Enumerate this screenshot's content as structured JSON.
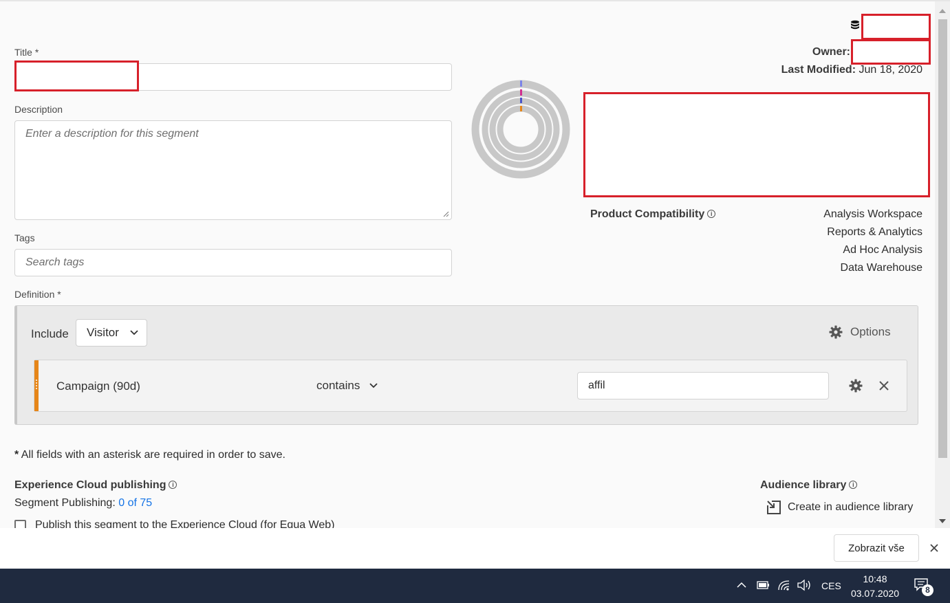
{
  "form": {
    "title_label": "Title",
    "required_mark": "*",
    "description_label": "Description",
    "description_placeholder": "Enter a description for this segment",
    "tags_label": "Tags",
    "tags_placeholder": "Search tags",
    "definition_label": "Definition"
  },
  "meta": {
    "owner_label": "Owner:",
    "last_modified_label": "Last Modified:",
    "last_modified_value": "Jun 18, 2020"
  },
  "compatibility": {
    "label": "Product Compatibility",
    "items": [
      "Analysis Workspace",
      "Reports & Analytics",
      "Ad Hoc Analysis",
      "Data Warehouse"
    ]
  },
  "definition": {
    "include_label": "Include",
    "container_value": "Visitor",
    "options_label": "Options",
    "rule": {
      "dimension": "Campaign (90d)",
      "operator": "contains",
      "value": "affil"
    }
  },
  "footer": {
    "required_note": "All fields with an asterisk are required in order to save.",
    "ec_publishing_title": "Experience Cloud publishing",
    "segment_publishing_label": "Segment Publishing:",
    "segment_publishing_value": "0 of 75",
    "publish_checkbox_label": "Publish this segment to the Experience Cloud (for Equa Web)",
    "audience_library_title": "Audience library",
    "create_audience_label": "Create in audience library"
  },
  "notification": {
    "show_all_label": "Zobrazit vše"
  },
  "taskbar": {
    "language": "CES",
    "time": "10:48",
    "date": "03.07.2020",
    "notification_count": "8"
  },
  "colors": {
    "accent_orange": "#e68619",
    "link_blue": "#1473e6",
    "redaction_red": "#d7202a",
    "taskbar_bg": "#1f2a3f"
  }
}
